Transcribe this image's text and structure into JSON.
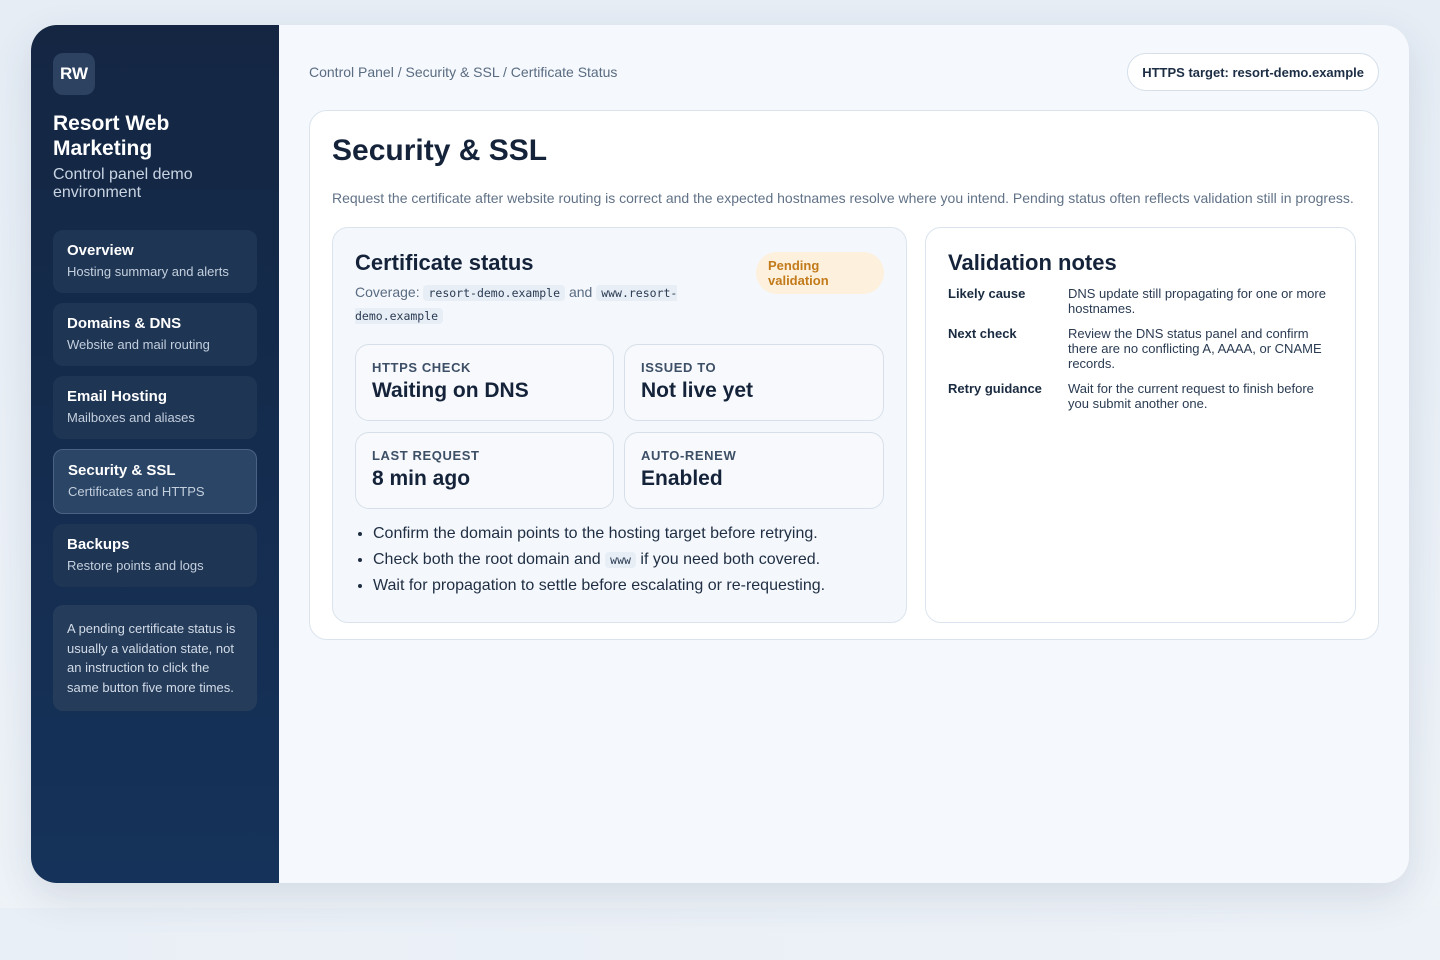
{
  "sidebar": {
    "logo": "RW",
    "title": "Resort Web Marketing",
    "subtitle": "Control panel demo environment",
    "items": [
      {
        "label": "Overview",
        "desc": "Hosting summary and alerts"
      },
      {
        "label": "Domains & DNS",
        "desc": "Website and mail routing"
      },
      {
        "label": "Email Hosting",
        "desc": "Mailboxes and aliases"
      },
      {
        "label": "Security & SSL",
        "desc": "Certificates and HTTPS"
      },
      {
        "label": "Backups",
        "desc": "Restore points and logs"
      }
    ],
    "note": "A pending certificate status is usually a validation state, not an instruction to click the same button five more times."
  },
  "header": {
    "breadcrumb": "Control Panel / Security & SSL / Certificate Status",
    "target": "HTTPS target: resort-demo.example"
  },
  "page": {
    "title": "Security & SSL",
    "description": "Request the certificate after website routing is correct and the expected hostnames resolve where you intend. Pending status often reflects validation still in progress."
  },
  "certificate": {
    "title": "Certificate status",
    "coverage_prefix": "Coverage:",
    "domain1": "resort-demo.example",
    "and": "and",
    "domain2": "www.resort-demo.example",
    "badge": "Pending validation",
    "stats": [
      {
        "label": "HTTPS CHECK",
        "value": "Waiting on DNS"
      },
      {
        "label": "ISSUED TO",
        "value": "Not live yet"
      },
      {
        "label": "LAST REQUEST",
        "value": "8 min ago"
      },
      {
        "label": "AUTO-RENEW",
        "value": "Enabled"
      }
    ],
    "tips": {
      "tip1": "Confirm the domain points to the hosting target before retrying.",
      "tip2_a": "Check both the root domain and",
      "tip2_code": "www",
      "tip2_b": "if you need both covered.",
      "tip3": "Wait for propagation to settle before escalating or re-requesting."
    }
  },
  "notes": {
    "title": "Validation notes",
    "rows": [
      {
        "key": "Likely cause",
        "value": "DNS update still propagating for one or more hostnames."
      },
      {
        "key": "Next check",
        "value": "Review the DNS status panel and confirm there are no conflicting A, AAAA, or CNAME records."
      },
      {
        "key": "Retry guidance",
        "value": "Wait for the current request to finish before you submit another one."
      }
    ]
  },
  "colors": {
    "sidebar_bg": "#15325a",
    "badge_bg": "#fdf0dd",
    "badge_text": "#c27a1a"
  }
}
